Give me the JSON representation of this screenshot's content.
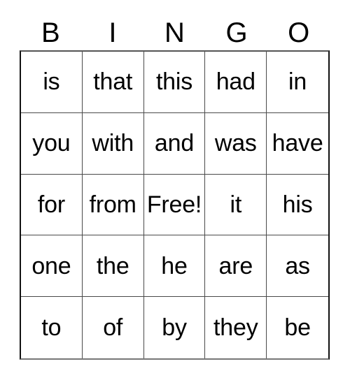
{
  "card": {
    "title_letters": [
      "B",
      "I",
      "N",
      "G",
      "O"
    ],
    "free_space_label": "Free!",
    "colors": {
      "background": "#ffffff",
      "text": "#000000",
      "grid_line": "#4a4a4a",
      "grid_outer": "#111111"
    },
    "grid": {
      "columns": 5,
      "rows": 5,
      "cells": [
        [
          "is",
          "that",
          "this",
          "had",
          "in"
        ],
        [
          "you",
          "with",
          "and",
          "was",
          "have"
        ],
        [
          "for",
          "from",
          "Free!",
          "it",
          "his"
        ],
        [
          "one",
          "the",
          "he",
          "are",
          "as"
        ],
        [
          "to",
          "of",
          "by",
          "they",
          "be"
        ]
      ]
    }
  }
}
